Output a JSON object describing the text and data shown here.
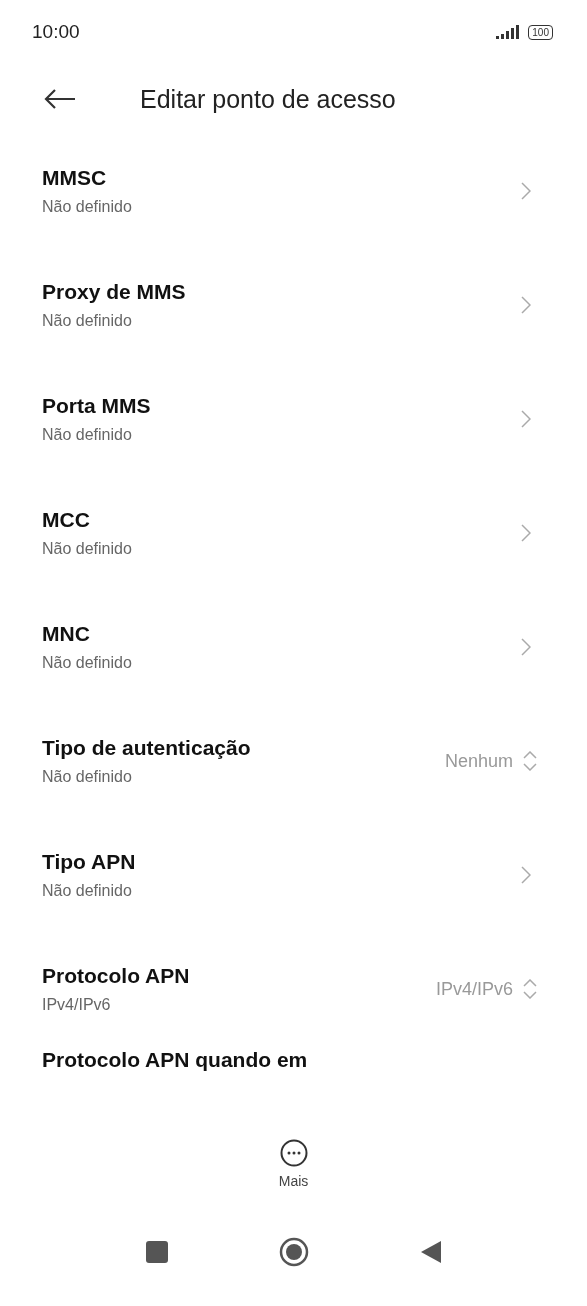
{
  "status_bar": {
    "time": "10:00",
    "battery": "100"
  },
  "header": {
    "title": "Editar ponto de acesso"
  },
  "items": [
    {
      "title": "MMSC",
      "subtitle": "Não definido",
      "kind": "chevron"
    },
    {
      "title": "Proxy de MMS",
      "subtitle": "Não definido",
      "kind": "chevron"
    },
    {
      "title": "Porta MMS",
      "subtitle": "Não definido",
      "kind": "chevron"
    },
    {
      "title": "MCC",
      "subtitle": "Não definido",
      "kind": "chevron"
    },
    {
      "title": "MNC",
      "subtitle": "Não definido",
      "kind": "chevron"
    },
    {
      "title": "Tipo de autenticação",
      "subtitle": "Não definido",
      "kind": "select",
      "value": "Nenhum"
    },
    {
      "title": "Tipo APN",
      "subtitle": "Não definido",
      "kind": "chevron"
    },
    {
      "title": "Protocolo APN",
      "subtitle": "IPv4/IPv6",
      "kind": "select",
      "value": "IPv4/IPv6"
    },
    {
      "title": "Protocolo APN quando em",
      "kind": "cut"
    }
  ],
  "bottom_action": {
    "label": "Mais"
  }
}
